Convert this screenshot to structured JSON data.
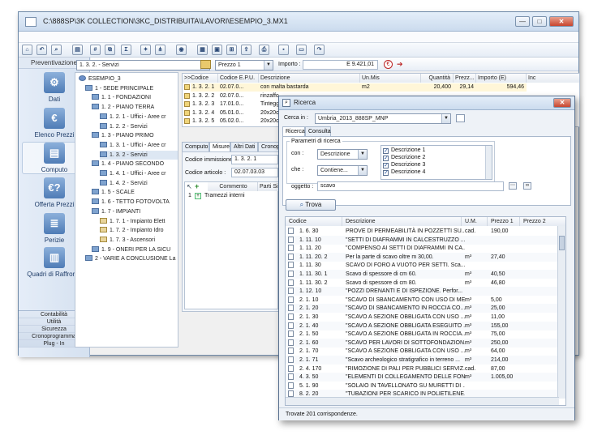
{
  "main": {
    "title": "C:\\888SP\\3K COLLECTION\\3KC_DISTRIBUITA\\LAVORI\\ESEMPIO_3.MX1",
    "nav_header": "Preventivazione",
    "nav": [
      {
        "label": "Dati",
        "icon": "gear-icon"
      },
      {
        "label": "Elenco Prezzi",
        "icon": "euro-icon"
      },
      {
        "label": "Computo",
        "icon": "document-icon"
      },
      {
        "label": "Offerta Prezzi",
        "icon": "euro-question-icon"
      },
      {
        "label": "Perizie",
        "icon": "list-icon"
      },
      {
        "label": "Quadri di Raffronto",
        "icon": "bar-chart-icon"
      }
    ],
    "links": [
      "Contabilità",
      "Utilità",
      "Sicurezza",
      "Cronoprogramma",
      "Plug - In"
    ],
    "pane_title": "Computo",
    "section_combo": "1. 3. 2. - Servizi",
    "price_combo": "Prezzo 1",
    "importo_label": "Importo :",
    "importo_value": "E  9.421,01",
    "tree": [
      {
        "label": "ESEMPIO_3"
      },
      {
        "label": "1 - SEDE PRINCIPALE"
      },
      {
        "label": "1. 1 - FONDAZIONI"
      },
      {
        "label": "1. 2 - PIANO TERRA"
      },
      {
        "label": "1. 2. 1 - Uffici - Aree cr"
      },
      {
        "label": "1. 2. 2 - Servizi"
      },
      {
        "label": "1. 3 - PIANO PRIMO"
      },
      {
        "label": "1. 3. 1 - Uffici - Aree cr"
      },
      {
        "label": "1. 3. 2 - Servizi"
      },
      {
        "label": "1. 4 - PIANO SECONDO"
      },
      {
        "label": "1. 4. 1 - Uffici - Aree cr"
      },
      {
        "label": "1. 4. 2 - Servizi"
      },
      {
        "label": "1. 5 - SCALE"
      },
      {
        "label": "1. 6 - TETTO FOTOVOLTA"
      },
      {
        "label": "1. 7 - IMPIANTI"
      },
      {
        "label": "1. 7. 1 - Impianto Elett"
      },
      {
        "label": "1. 7. 2 - Impianto Idro"
      },
      {
        "label": "1. 7. 3 - Ascensori"
      },
      {
        "label": "1. 9 - ONERI PER LA SICU"
      },
      {
        "label": "2 - VARIE A CONCLUSIONE La"
      }
    ],
    "grid_headers": [
      ">>Codice",
      "Codice E.P.U.",
      "Descrizione",
      "Un.Mis",
      "Quantità",
      "Prezz...",
      "Importo (E)",
      "Inc"
    ],
    "grid_rows": [
      {
        "codice": "1. 3. 2. 1",
        "epu": "02.07.0...",
        "desc": "con malta bastarda",
        "um": "m2",
        "qta": "20,400",
        "prezzo": "29,14",
        "importo": "594,46"
      },
      {
        "codice": "1. 3. 2. 2",
        "epu": "02.07.0...",
        "desc": "rinzaffo",
        "um": "",
        "qta": "",
        "prezzo": "",
        "importo": ""
      },
      {
        "codice": "1. 3. 2. 3",
        "epu": "17.01.0...",
        "desc": "Tinteggi",
        "um": "",
        "qta": "",
        "prezzo": "",
        "importo": ""
      },
      {
        "codice": "1. 3. 2. 4",
        "epu": "05.01.0...",
        "desc": "20x20cm",
        "um": "",
        "qta": "",
        "prezzo": "",
        "importo": ""
      },
      {
        "codice": "1. 3. 2. 5",
        "epu": "05.02.0...",
        "desc": "20x20cm",
        "um": "",
        "qta": "",
        "prezzo": "",
        "importo": ""
      }
    ],
    "detail_tabs": [
      "Computo",
      "Misure",
      "Altri Dati",
      "Cronopr"
    ],
    "codice_immissione_label": "Codice immissione :",
    "codice_immissione": "1. 3. 2. 1",
    "codice_articolo_label": "Codice articolo :",
    "codice_articolo": "02.07.03.03",
    "measure_headers": [
      "Commento",
      "Parti Si"
    ],
    "measure_row": {
      "num": "1",
      "commento": "Tramezzi interni"
    }
  },
  "ricerca": {
    "title": "Ricerca",
    "cerca_label": "Cerca in :",
    "cerca_value": "Umbria_2013_888SP_MNP",
    "tabs": [
      "Ricerca",
      "Consulta"
    ],
    "params_label": "Parametri di ricerca",
    "con_label": "con :",
    "con_value": "Descrizione",
    "che_label": "che :",
    "che_value": "Contiene...",
    "checks": [
      "Descrizione 1",
      "Descrizione 2",
      "Descrizione 3",
      "Descrizione 4"
    ],
    "oggetto_label": "oggetto :",
    "oggetto_value": "scavo",
    "trova": "Trova",
    "headers": [
      "Codice",
      "Descrizione",
      "U.M.",
      "Prezzo 1",
      "Prezzo 2"
    ],
    "rows": [
      {
        "c": "1. 6.  30",
        "d": "PROVE DI PERMEABILITÀ IN POZZETTI SU...",
        "u": "cad.",
        "p": "190,00"
      },
      {
        "c": "1. 11.  10",
        "d": "\"SETTI DI DIAFRAMMI IN CALCESTRUZZO ...",
        "u": "",
        "p": ""
      },
      {
        "c": "1. 11.  20",
        "d": "\"COMPENSO AI SETTI DI DIAFRAMMI IN CA...",
        "u": "",
        "p": ""
      },
      {
        "c": "1. 11.  20.  2",
        "d": "Per la parte di scavo oltre m 30,00.",
        "u": "m³",
        "p": "27,40"
      },
      {
        "c": "1. 11.  30",
        "d": "SCAVO DI FORO A VUOTO PER SETTI.   Sca...",
        "u": "",
        "p": ""
      },
      {
        "c": "1. 11.  30.  1",
        "d": "Scavo di spessore di cm 60.",
        "u": "m³",
        "p": "40,50"
      },
      {
        "c": "1. 11.  30.  2",
        "d": "Scavo di spessore di cm 80.",
        "u": "m³",
        "p": "46,80"
      },
      {
        "c": "1. 12.  10",
        "d": "\"POZZI DRENANTI E DI ISPEZIONE.   Perfor...",
        "u": "",
        "p": ""
      },
      {
        "c": "2. 1.  10",
        "d": "\"SCAVO DI SBANCAMENTO CON USO DI ME...",
        "u": "m³",
        "p": "5,00"
      },
      {
        "c": "2. 1.  20",
        "d": "\"SCAVO DI SBANCAMENTO IN ROCCIA CO...",
        "u": "m³",
        "p": "25,00"
      },
      {
        "c": "2. 1.  30",
        "d": "\"SCAVO A SEZIONE OBBLIGATA CON USO ...",
        "u": "m³",
        "p": "11,00"
      },
      {
        "c": "2. 1.  40",
        "d": "\"SCAVO A SEZIONE OBBLIGATA ESEGUITO ...",
        "u": "m³",
        "p": "155,00"
      },
      {
        "c": "2. 1.  50",
        "d": "\"SCAVO A SEZIONE OBBLIGATA IN ROCCIA...",
        "u": "m³",
        "p": "75,00"
      },
      {
        "c": "2. 1.  60",
        "d": "\"SCAVO PER LAVORI DI SOTTOFONDAZION...",
        "u": "m³",
        "p": "250,00"
      },
      {
        "c": "2. 1.  70",
        "d": "\"SCAVO A SEZIONE OBBLIGATA CON USO ...",
        "u": "m³",
        "p": "64,00"
      },
      {
        "c": "2. 1.  71",
        "d": "\"Scavo archeologico stratigrafico in terreno ...",
        "u": "m³",
        "p": "214,00"
      },
      {
        "c": "2. 4.  170",
        "d": "\"RIMOZIONE DI PALI PER PUBBLICI SERVIZ...",
        "u": "cad.",
        "p": "87,00"
      },
      {
        "c": "4. 3.  50",
        "d": "\"ELEMENTI DI COLLEGAMENTO DELLE FON...",
        "u": "m³",
        "p": "1.005,00"
      },
      {
        "c": "5. 1.  90",
        "d": "\"SOLAIO IN TAVELLONATO SU MURETTI DI ...",
        "u": "",
        "p": ""
      },
      {
        "c": "8. 2.  20",
        "d": "\"TUBAZIONI PER SCARICO IN POLIETILENE...",
        "u": "",
        "p": ""
      }
    ],
    "status": "Trovate 201 corrispondenze."
  }
}
